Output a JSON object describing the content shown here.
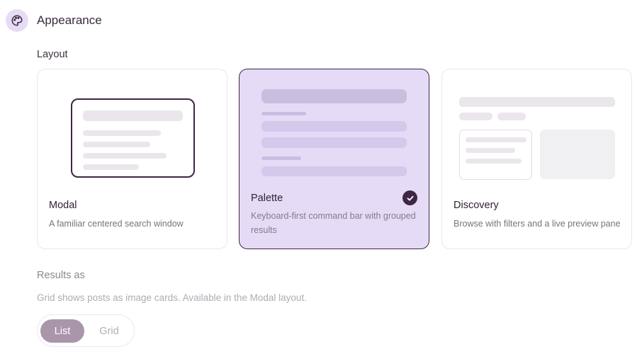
{
  "header": {
    "title": "Appearance",
    "icon": "palette-icon"
  },
  "layout_section": {
    "label": "Layout"
  },
  "layouts": [
    {
      "id": "modal",
      "title": "Modal",
      "description": "A familiar centered search window",
      "selected": false
    },
    {
      "id": "palette",
      "title": "Palette",
      "description": "Keyboard-first command bar with grouped results",
      "selected": true
    },
    {
      "id": "discovery",
      "title": "Discovery",
      "description": "Browse with filters and a live preview pane",
      "selected": false
    }
  ],
  "results_section": {
    "label": "Results as",
    "hint": "Grid shows posts as image cards. Available in the Modal layout.",
    "options": [
      {
        "label": "List",
        "active": true
      },
      {
        "label": "Grid",
        "active": false
      }
    ]
  },
  "colors": {
    "accent": "#3e2744",
    "selected_card_bg": "#e6dbf6",
    "toggle_active_bg": "#a996ab"
  }
}
